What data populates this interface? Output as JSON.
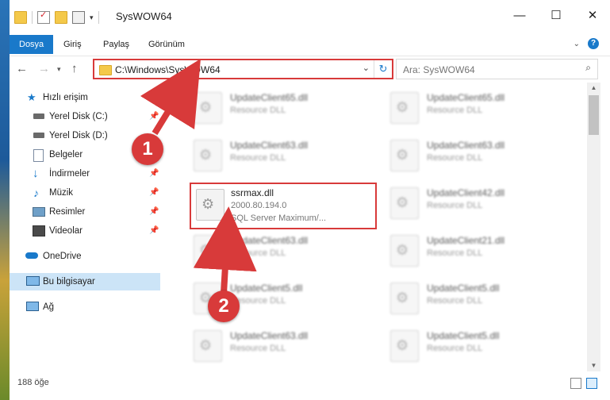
{
  "window": {
    "title": "SysWOW64",
    "controls": {
      "minimize": "—",
      "maximize": "☐",
      "close": "✕"
    }
  },
  "ribbon": {
    "tabs": [
      "Dosya",
      "Giriş",
      "Paylaş",
      "Görünüm"
    ],
    "accent_color": "#1979ca",
    "help": "?"
  },
  "navigation": {
    "address": "C:\\Windows\\SysWOW64",
    "search_placeholder": "Ara: SysWOW64"
  },
  "sidebar": {
    "items": [
      {
        "label": "Hızlı erişim",
        "icon": "star-icon"
      },
      {
        "label": "Yerel Disk (C:)",
        "icon": "drive-icon",
        "pinned": true
      },
      {
        "label": "Yerel Disk (D:)",
        "icon": "drive-icon"
      },
      {
        "label": "Belgeler",
        "icon": "documents-icon"
      },
      {
        "label": "İndirmeler",
        "icon": "download-icon",
        "pinned": true
      },
      {
        "label": "Müzik",
        "icon": "music-icon",
        "pinned": true
      },
      {
        "label": "Resimler",
        "icon": "pictures-icon",
        "pinned": true
      },
      {
        "label": "Videolar",
        "icon": "video-icon",
        "pinned": true
      },
      {
        "label": "OneDrive",
        "icon": "cloud-icon"
      },
      {
        "label": "Bu bilgisayar",
        "icon": "computer-icon",
        "selected": true
      },
      {
        "label": "Ağ",
        "icon": "network-icon"
      }
    ]
  },
  "files": [
    {
      "name": "UpdateClient65.dll",
      "desc": "Resource DLL"
    },
    {
      "name": "UpdateClient65.dll",
      "desc": "Resource DLL"
    },
    {
      "name": "UpdateClient63.dll",
      "desc": "Resource DLL"
    },
    {
      "name": "UpdateClient63.dll",
      "desc": "Resource DLL"
    },
    {
      "name": "ssrmax.dll",
      "desc": "2000.80.194.0",
      "desc2": "SQL Server Maximum/...",
      "highlight": true
    },
    {
      "name": "UpdateClient42.dll",
      "desc": "Resource DLL"
    },
    {
      "name": "UpdateClient63.dll",
      "desc": "Resource DLL"
    },
    {
      "name": "UpdateClient21.dll",
      "desc": "Resource DLL"
    },
    {
      "name": "UpdateClient5.dll",
      "desc": "Resource DLL"
    },
    {
      "name": "UpdateClient5.dll",
      "desc": "Resource DLL"
    },
    {
      "name": "UpdateClient63.dll",
      "desc": "Resource DLL"
    },
    {
      "name": "UpdateClient5.dll",
      "desc": "Resource DLL"
    }
  ],
  "status": {
    "item_count": "188 öğe"
  },
  "annotations": {
    "step1": "1",
    "step2": "2",
    "color": "#d83a3a"
  }
}
